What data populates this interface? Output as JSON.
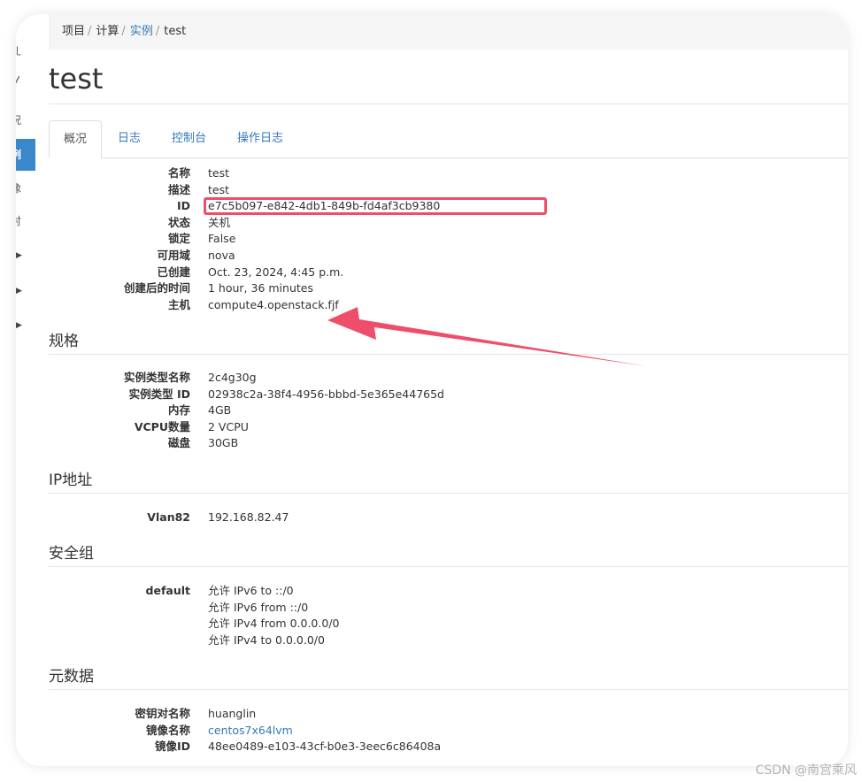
{
  "sidebar": {
    "items": [
      {
        "label": "ㄦ"
      },
      {
        "label": "╱"
      },
      {
        "label": "况"
      },
      {
        "label": "例"
      },
      {
        "label": "像"
      },
      {
        "label": "对"
      }
    ]
  },
  "breadcrumb": {
    "items": [
      "项目",
      "计算",
      "实例",
      "test"
    ],
    "separator": "/"
  },
  "page": {
    "title": "test"
  },
  "tabs": [
    {
      "label": "概况"
    },
    {
      "label": "日志"
    },
    {
      "label": "控制台"
    },
    {
      "label": "操作日志"
    }
  ],
  "overview": [
    {
      "key": "名称",
      "value": "test"
    },
    {
      "key": "描述",
      "value": "test"
    },
    {
      "key": "ID",
      "value": "e7c5b097-e842-4db1-849b-fd4af3cb9380"
    },
    {
      "key": "状态",
      "value": "关机"
    },
    {
      "key": "锁定",
      "value": "False"
    },
    {
      "key": "可用域",
      "value": "nova"
    },
    {
      "key": "已创建",
      "value": "Oct. 23, 2024, 4:45 p.m."
    },
    {
      "key": "创建后的时间",
      "value": "1 hour, 36 minutes"
    },
    {
      "key": "主机",
      "value": "compute4.openstack.fjf"
    }
  ],
  "flavor_section": {
    "title": "规格",
    "items": [
      {
        "key": "实例类型名称",
        "value": "2c4g30g"
      },
      {
        "key": "实例类型 ID",
        "value": "02938c2a-38f4-4956-bbbd-5e365e44765d"
      },
      {
        "key": "内存",
        "value": "4GB"
      },
      {
        "key": "VCPU数量",
        "value": "2 VCPU"
      },
      {
        "key": "磁盘",
        "value": "30GB"
      }
    ]
  },
  "ip_section": {
    "title": "IP地址",
    "items": [
      {
        "key": "Vlan82",
        "value": "192.168.82.47"
      }
    ]
  },
  "secgroup_section": {
    "title": "安全组",
    "group": "default",
    "rules": [
      "允许 IPv6 to ::/0",
      "允许 IPv6 from ::/0",
      "允许 IPv4 from 0.0.0.0/0",
      "允许 IPv4 to 0.0.0.0/0"
    ]
  },
  "metadata_section": {
    "title": "元数据",
    "items": [
      {
        "key": "密钥对名称",
        "value": "huanglin"
      },
      {
        "key": "镜像名称",
        "value": "centos7x64lvm"
      },
      {
        "key": "镜像ID",
        "value": "48ee0489-e103-43cf-b0e3-3eec6c86408a"
      }
    ]
  },
  "annotation": {
    "color": "#ef4e6b"
  },
  "watermark": "CSDN @南宫乘风"
}
